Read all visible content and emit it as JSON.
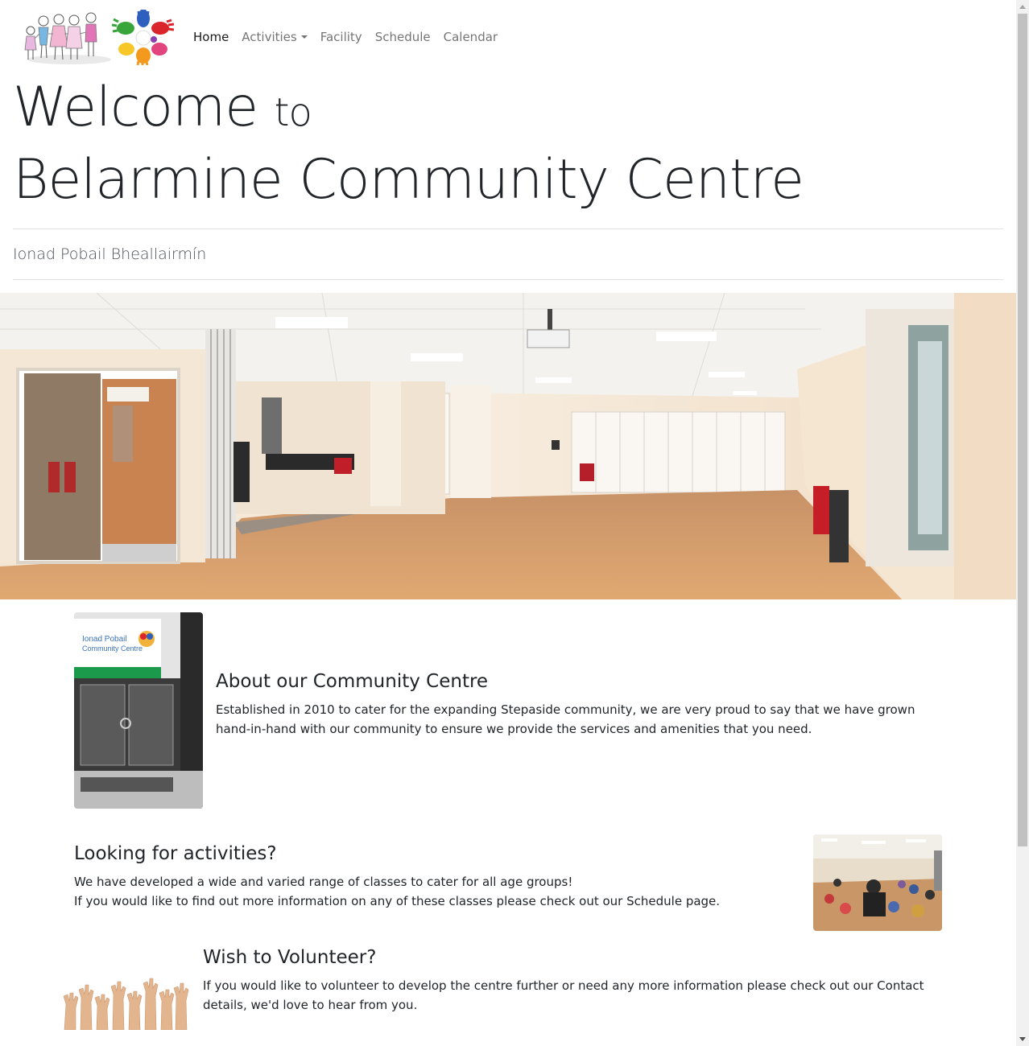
{
  "nav": {
    "items": [
      {
        "label": "Home",
        "active": true
      },
      {
        "label": "Activities",
        "dropdown": true
      },
      {
        "label": "Facility"
      },
      {
        "label": "Schedule"
      },
      {
        "label": "Calendar"
      }
    ]
  },
  "hero": {
    "welcome": "Welcome",
    "to": "to",
    "name": "Belarmine Community Centre",
    "subtitle": "Ionad Pobail Bheallairmín"
  },
  "about": {
    "title": "About our Community Centre",
    "text": "Established in 2010 to cater for the expanding Stepaside community, we are very proud to say that we have grown hand-in-hand with our community to ensure we provide the services and amenities that you need.",
    "sign_line1": "Ionad Pobail",
    "sign_line2": "Community Centre"
  },
  "activities": {
    "title": "Looking for activities?",
    "line1": "We have developed a wide and varied range of classes to cater for all age groups!",
    "line2": "If you would like to find out more information on any of these classes please check out our Schedule page."
  },
  "volunteer": {
    "title": "Wish to Volunteer?",
    "text": "If you would like to volunteer to develop the centre further or need any more information please check out our Contact details, we'd love to hear from you."
  },
  "colors": {
    "text": "#212529",
    "nav_muted": "#8c8c8c",
    "floor": "#d59a64",
    "wall": "#f2e2cd",
    "sign_green": "#1a9a4a"
  }
}
